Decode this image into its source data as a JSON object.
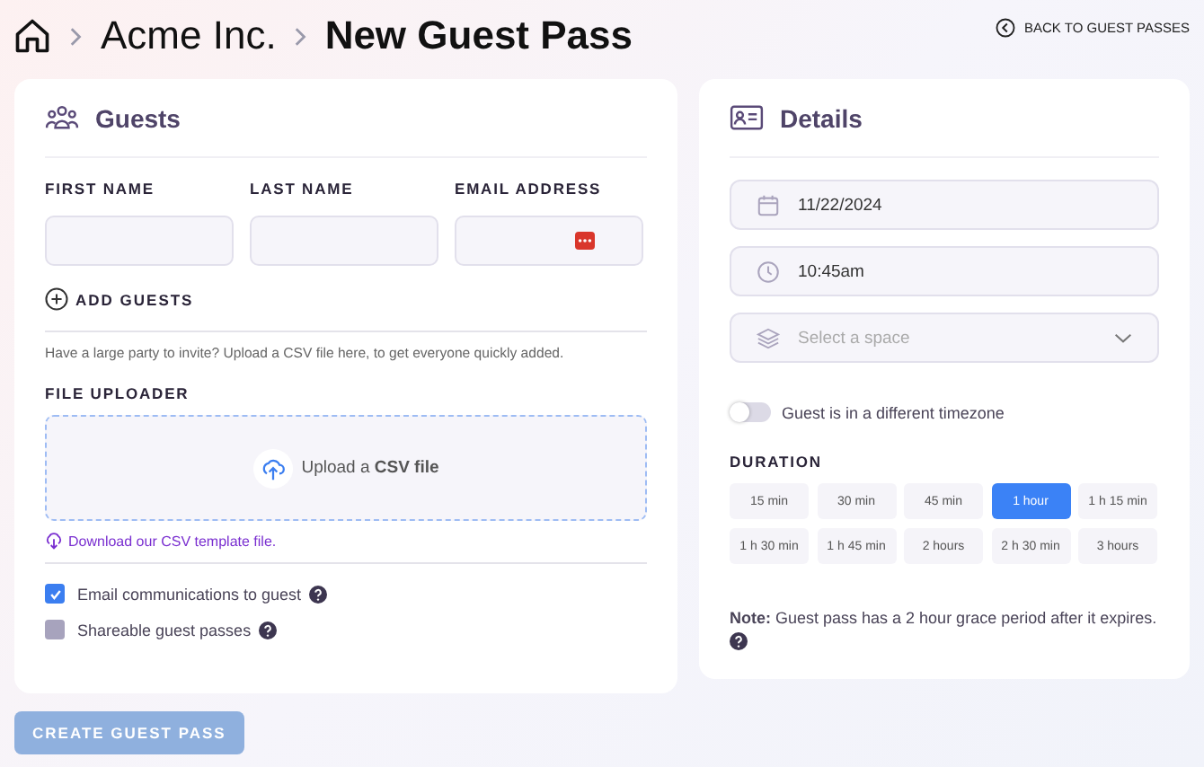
{
  "breadcrumb": [
    "Acme Inc.",
    "New Guest Pass"
  ],
  "back_link": "BACK TO GUEST PASSES",
  "guests": {
    "title": "Guests",
    "columns": [
      "FIRST NAME",
      "LAST NAME",
      "EMAIL ADDRESS"
    ],
    "add_guests": "ADD GUESTS",
    "csv_hint": "Have a large party to invite? Upload a CSV file here, to get everyone quickly added.",
    "uploader_label": "FILE UPLOADER",
    "upload_text": "Upload a **CSV file**",
    "template_link": "Download our CSV template file.",
    "options": [
      {
        "label": "Email communications to guest",
        "checked": true
      },
      {
        "label": "Shareable guest passes",
        "checked": false
      }
    ]
  },
  "create_button": {
    "label": "CREATE GUEST PASS",
    "disabled": true
  },
  "details": {
    "title": "Details",
    "date": "11/22/2024",
    "time": "10:45am",
    "space_placeholder": "Select a space",
    "timezone_toggle": {
      "label": "Guest is in a different timezone",
      "on": false
    },
    "duration_label": "DURATION",
    "durations": [
      {
        "label": "15 min",
        "selected": false
      },
      {
        "label": "30 min",
        "selected": false
      },
      {
        "label": "45 min",
        "selected": false
      },
      {
        "label": "1 hour",
        "selected": true
      },
      {
        "label": "1 h 15 min",
        "selected": false
      },
      {
        "label": "1 h 30 min",
        "selected": false
      },
      {
        "label": "1 h 45 min",
        "selected": false
      },
      {
        "label": "2 hours",
        "selected": false
      },
      {
        "label": "2 h 30 min",
        "selected": false
      },
      {
        "label": "3 hours",
        "selected": false
      }
    ],
    "note": "**Note:** Guest pass has a 2 hour grace period after it expires."
  }
}
